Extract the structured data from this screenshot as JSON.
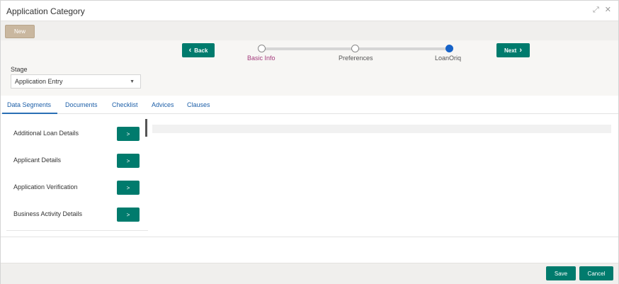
{
  "window": {
    "title": "Application Category",
    "controls": [
      {
        "name": "maximize-icon",
        "glyph": "⤢"
      },
      {
        "name": "close-icon",
        "glyph": "✕"
      }
    ]
  },
  "toolbar": {
    "new_label": "New"
  },
  "navigation": {
    "back_label": "Back",
    "back_icon": "‹",
    "next_label": "Next",
    "next_icon": "›",
    "steps": [
      {
        "label": "Basic Info",
        "state": "visited"
      },
      {
        "label": "Preferences",
        "state": "pending"
      },
      {
        "label": "LoanOriq",
        "state": "current"
      }
    ]
  },
  "stage": {
    "label": "Stage",
    "selected": "Application Entry",
    "caret": "▼"
  },
  "tabs": [
    {
      "label": "Data Segments",
      "active": true
    },
    {
      "label": "Documents",
      "active": false
    },
    {
      "label": "Checklist",
      "active": false
    },
    {
      "label": "Advices",
      "active": false
    },
    {
      "label": "Clauses",
      "active": false
    }
  ],
  "segments": [
    {
      "label": "Additional Loan Details",
      "action": ">"
    },
    {
      "label": "Applicant Details",
      "action": ">"
    },
    {
      "label": "Application Verification",
      "action": ">"
    },
    {
      "label": "Business Activity Details",
      "action": ">"
    }
  ],
  "footer": {
    "save_label": "Save",
    "cancel_label": "Cancel"
  },
  "colors": {
    "accent": "#007b6d",
    "new_button": "#c9b79f",
    "current_step": "#1763c8",
    "visited_step_label": "#a33a7b",
    "tab_text": "#1d5fa8"
  }
}
